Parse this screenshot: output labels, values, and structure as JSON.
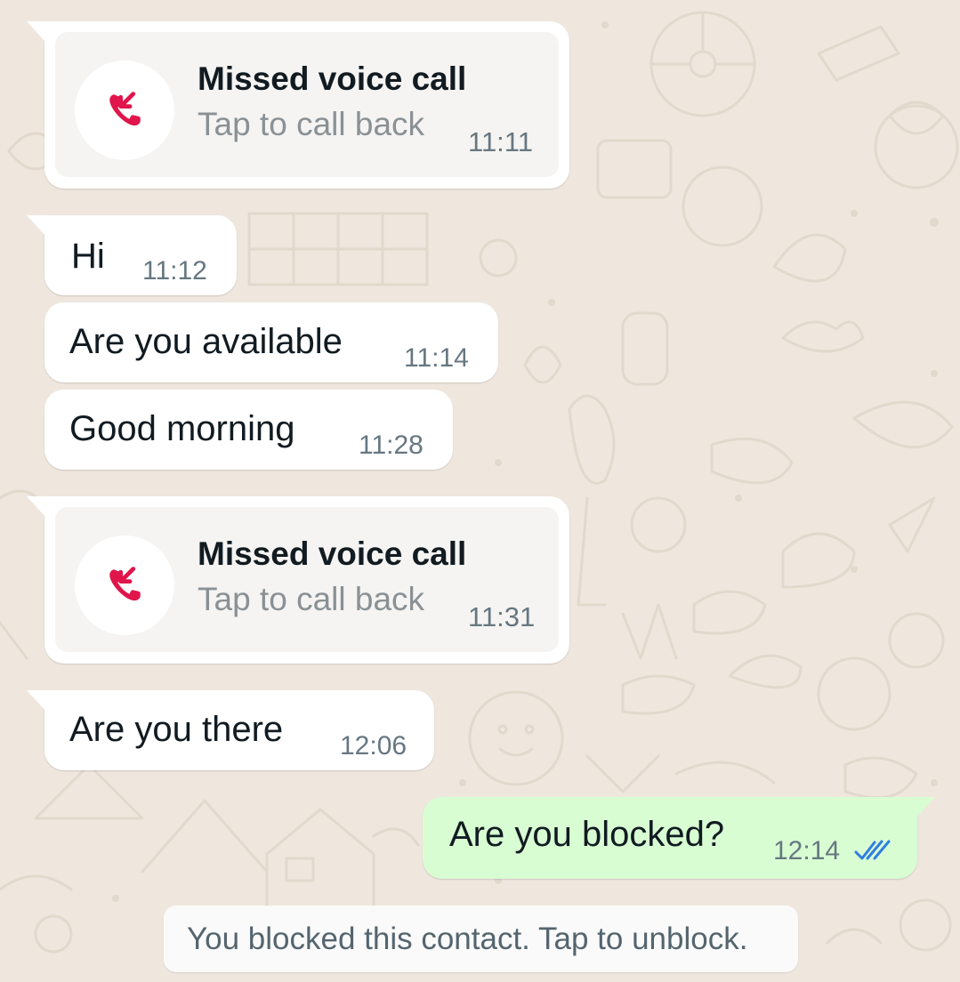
{
  "chat": {
    "messages": [
      {
        "type": "missed-call",
        "direction": "incoming",
        "title": "Missed voice call",
        "subtitle": "Tap to call back",
        "time": "11:11",
        "icon": "missed-call-icon"
      },
      {
        "type": "text",
        "direction": "incoming",
        "text": "Hi",
        "time": "11:12"
      },
      {
        "type": "text",
        "direction": "incoming",
        "text": "Are you available",
        "time": "11:14"
      },
      {
        "type": "text",
        "direction": "incoming",
        "text": "Good morning",
        "time": "11:28"
      },
      {
        "type": "missed-call",
        "direction": "incoming",
        "title": "Missed voice call",
        "subtitle": "Tap to call back",
        "time": "11:31",
        "icon": "missed-call-icon"
      },
      {
        "type": "text",
        "direction": "incoming",
        "text": "Are you there",
        "time": "12:06"
      },
      {
        "type": "text",
        "direction": "outgoing",
        "text": "Are you blocked?",
        "time": "12:14",
        "status": "read",
        "status_icon": "double-check-icon"
      }
    ],
    "system_notice": "You blocked this contact. Tap to unblock."
  },
  "colors": {
    "wallpaper": "#efe7de",
    "incoming_bubble": "#ffffff",
    "outgoing_bubble": "#d9fdd3",
    "missed_call_red": "#e0154b",
    "read_ticks": "#2f7ee0",
    "timestamp": "#667781"
  }
}
